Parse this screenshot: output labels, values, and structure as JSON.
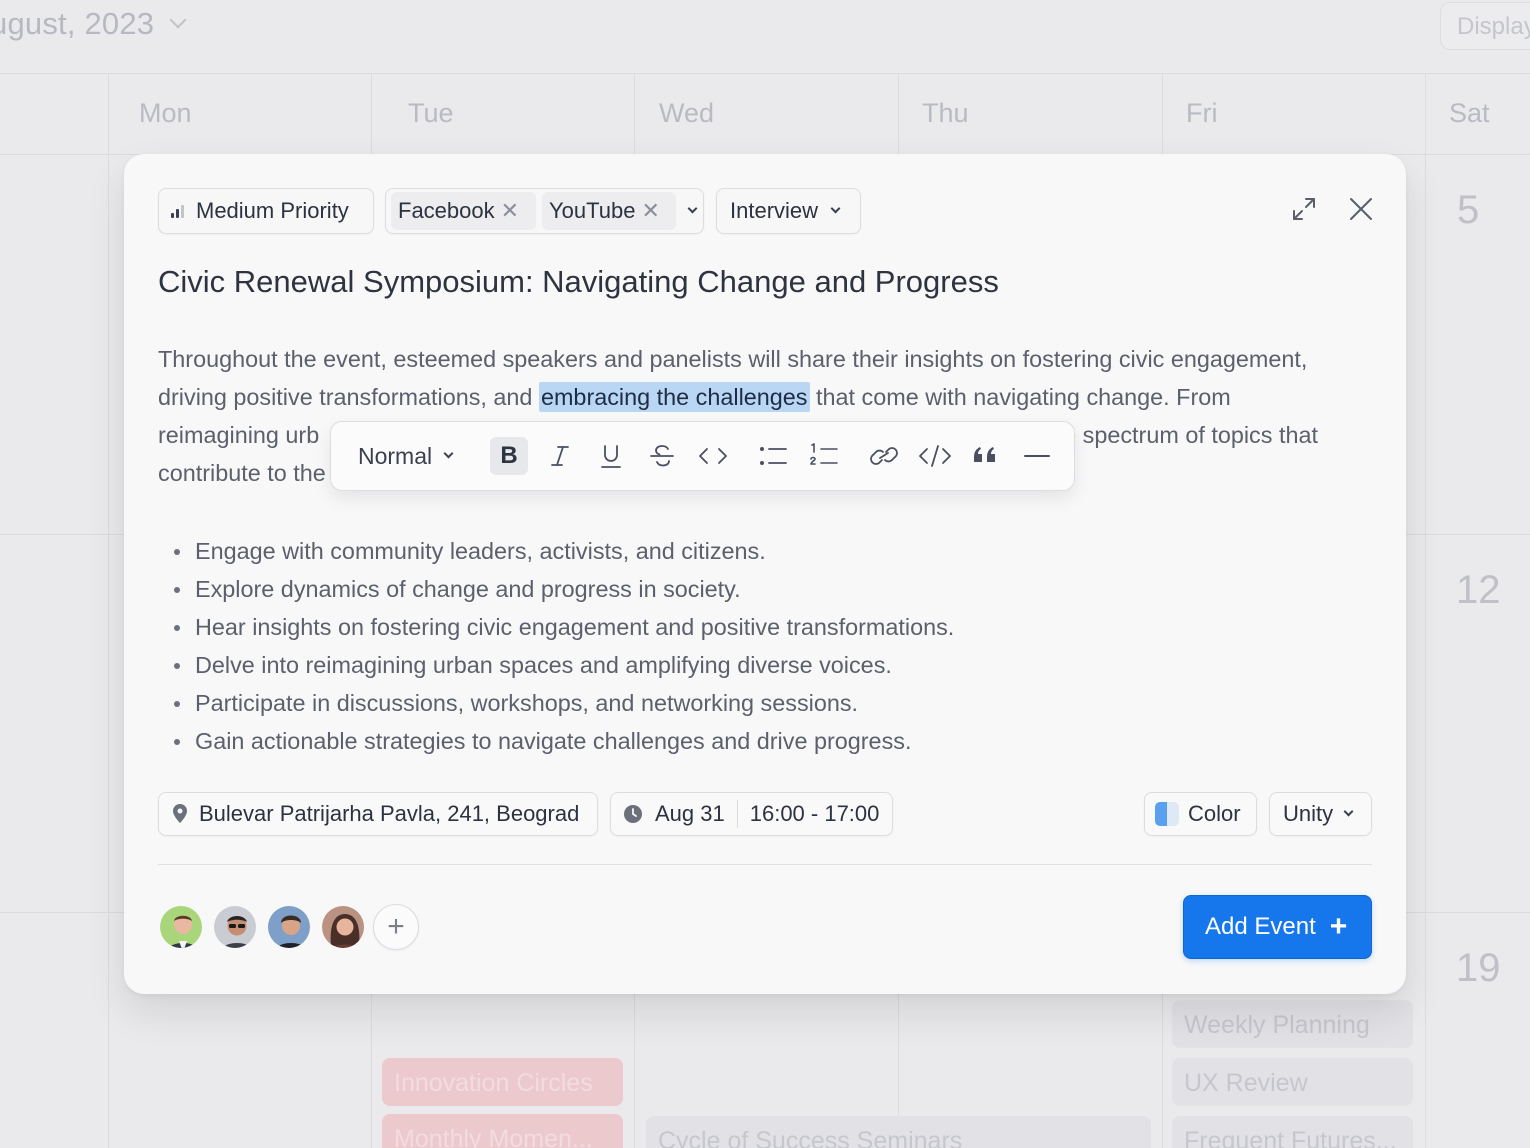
{
  "calendar": {
    "month_label": "ugust, 2023",
    "display_label": "Display",
    "days": [
      "Mon",
      "Tue",
      "Wed",
      "Thu",
      "Fri",
      "Sat"
    ],
    "day_numbers": [
      "5",
      "12",
      "19"
    ],
    "events": [
      "Weekly Planning",
      "Innovation Circles",
      "UX Review",
      "Monthly Momen...",
      "Cycle of Success Seminars",
      "Frequent Futures..."
    ]
  },
  "modal": {
    "priority_label": "Medium Priority",
    "tags": [
      "Facebook",
      "YouTube"
    ],
    "tag_remove_glyph": "✕",
    "event_type": "Interview",
    "title": "Civic Renewal Symposium: Navigating Change and Progress",
    "description": {
      "line1": "Throughout the event, esteemed speakers and panelists will share their insights on fostering civic engagement,",
      "line2_before": "driving positive transformations, and ",
      "line2_selected": "embracing the challenges",
      "line2_after": " that come with navigating change. From",
      "line3_left": "reimagining urb",
      "line3_right": "vide spectrum of topics that",
      "line4_left": "contribute to the"
    },
    "toolbar": {
      "style_label": "Normal",
      "bold_glyph": "B",
      "italic_glyph": "I",
      "underline_glyph": "U",
      "strike_glyph": "S"
    },
    "bullets": [
      "Engage with community leaders, activists, and citizens.",
      "Explore dynamics of change and progress in society.",
      "Hear insights on fostering civic engagement and positive transformations.",
      "Delve into reimagining urban spaces and amplifying diverse voices.",
      "Participate in discussions, workshops, and networking sessions.",
      "Gain actionable strategies to navigate challenges and drive progress."
    ],
    "location": "Bulevar Patrijarha Pavla, 241, Beograd",
    "date": "Aug 31",
    "time": "16:00 - 17:00",
    "color_label": "Color",
    "calendar_label": "Unity",
    "add_button": "Add Event",
    "add_glyph": "+",
    "add_person_glyph": "+",
    "colors": {
      "accent": "#1677ec",
      "selection": "#b9d6f4",
      "color_swatch": "#5aa0f0"
    }
  }
}
